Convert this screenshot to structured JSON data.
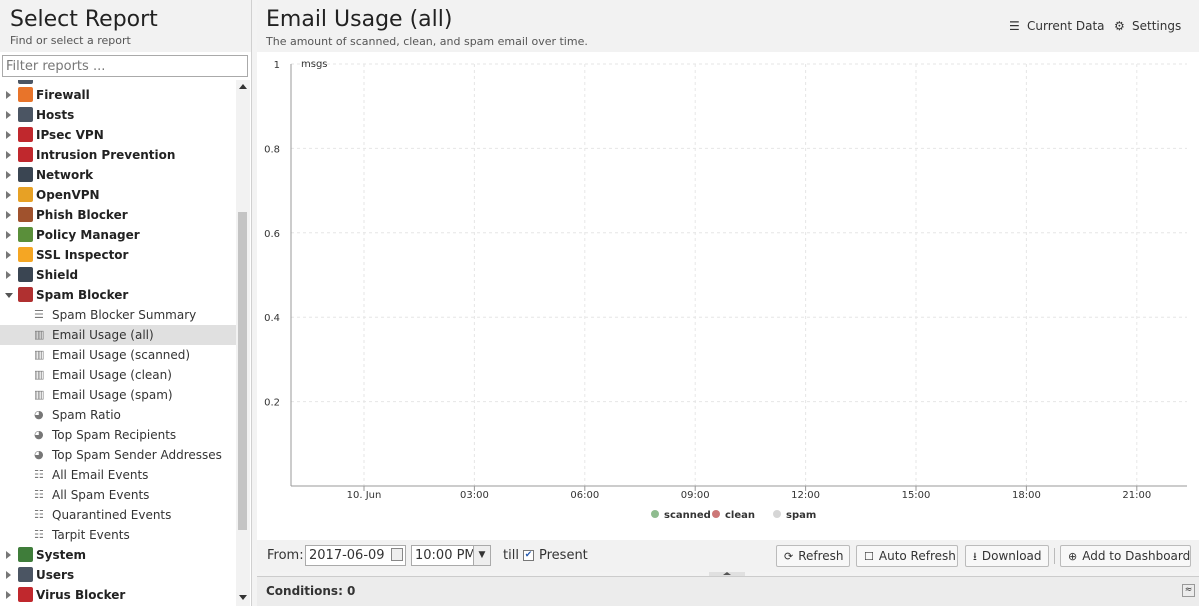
{
  "sidebar": {
    "title": "Select Report",
    "subtitle": "Find or select a report",
    "filter_placeholder": "Filter reports ...",
    "categories_top": [
      {
        "label": "Firewall",
        "color": "#e8742a"
      },
      {
        "label": "Hosts",
        "color": "#4b5563"
      },
      {
        "label": "IPsec VPN",
        "color": "#c0282d"
      },
      {
        "label": "Intrusion Prevention",
        "color": "#c0282d"
      },
      {
        "label": "Network",
        "color": "#3a4552"
      },
      {
        "label": "OpenVPN",
        "color": "#e7a125"
      },
      {
        "label": "Phish Blocker",
        "color": "#a0522d"
      },
      {
        "label": "Policy Manager",
        "color": "#5a8f3a"
      },
      {
        "label": "SSL Inspector",
        "color": "#f5a623"
      },
      {
        "label": "Shield",
        "color": "#3a4552"
      },
      {
        "label": "Spam Blocker",
        "color": "#b03030"
      }
    ],
    "spam_items": [
      {
        "label": "Spam Blocker Summary",
        "icon": "text-lines-icon"
      },
      {
        "label": "Email Usage (all)",
        "icon": "bar-chart-icon",
        "selected": true
      },
      {
        "label": "Email Usage (scanned)",
        "icon": "bar-chart-icon"
      },
      {
        "label": "Email Usage (clean)",
        "icon": "bar-chart-icon"
      },
      {
        "label": "Email Usage (spam)",
        "icon": "bar-chart-icon"
      },
      {
        "label": "Spam Ratio",
        "icon": "pie-chart-icon"
      },
      {
        "label": "Top Spam Recipients",
        "icon": "pie-chart-icon"
      },
      {
        "label": "Top Spam Sender Addresses",
        "icon": "pie-chart-icon"
      },
      {
        "label": "All Email Events",
        "icon": "list-icon"
      },
      {
        "label": "All Spam Events",
        "icon": "list-icon"
      },
      {
        "label": "Quarantined Events",
        "icon": "list-icon"
      },
      {
        "label": "Tarpit Events",
        "icon": "list-icon"
      }
    ],
    "categories_bottom": [
      {
        "label": "System",
        "color": "#3f7d3a"
      },
      {
        "label": "Users",
        "color": "#4b5563"
      },
      {
        "label": "Virus Blocker",
        "color": "#c0282d"
      }
    ]
  },
  "report": {
    "title": "Email Usage (all)",
    "description": "The amount of scanned, clean, and spam email over time.",
    "current_data_label": "Current Data",
    "settings_label": "Settings"
  },
  "controls": {
    "from_label": "From:",
    "from_date": "2017-06-09",
    "from_time": "10:00 PM",
    "till_label": "till",
    "present_label": "Present",
    "present_checked": true,
    "refresh_label": "Refresh",
    "auto_refresh_label": "Auto Refresh",
    "download_label": "Download",
    "add_dashboard_label": "Add to Dashboard"
  },
  "conditions": {
    "label": "Conditions: 0"
  },
  "chart_data": {
    "type": "line",
    "ylabel": "msgs",
    "ylim": [
      0,
      1
    ],
    "yticks": [
      "1",
      "0.8",
      "0.6",
      "0.4",
      "0.2"
    ],
    "xticks": [
      "10. Jun",
      "03:00",
      "06:00",
      "09:00",
      "12:00",
      "15:00",
      "18:00",
      "21:00"
    ],
    "series": [
      {
        "name": "scanned",
        "color": "#8fbc8f",
        "values": []
      },
      {
        "name": "clean",
        "color": "#cd7777",
        "values": []
      },
      {
        "name": "spam",
        "color": "#d6d6d6",
        "values": []
      }
    ],
    "grid": true,
    "legend": "bottom-center"
  }
}
